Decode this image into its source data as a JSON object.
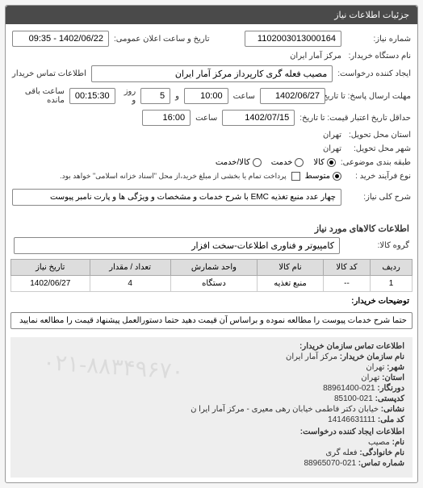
{
  "panel_title": "جزئیات اطلاعات نیاز",
  "fields": {
    "req_no_label": "شماره نیاز:",
    "req_no": "1102003013000164",
    "pub_date_label": "تاریخ و ساعت اعلان عمومی:",
    "pub_date": "1402/06/22 - 09:35",
    "buyer_label": "نام دستگاه خریدار:",
    "buyer": "مرکز آمار ایران",
    "creator_label": "ایجاد کننده درخواست:",
    "creator": "مصیب فعله گری کارپرداز مرکز آمار ایران",
    "contact_label": "اطلاعات تماس خریدار",
    "deadline_label": "مهلت ارسال پاسخ: تا تاریخ:",
    "deadline_date": "1402/06/27",
    "saat_label": "ساعت",
    "deadline_time": "10:00",
    "va_label": "و",
    "deadline_days": "5",
    "rooz_label": "روز و",
    "remain_time": "00:15:30",
    "remain_label": "ساعت باقی مانده",
    "validity_label": "حداقل تاریخ اعتبار قیمت: تا تاریخ:",
    "validity_date": "1402/07/15",
    "validity_time": "16:00",
    "province_label": "استان محل تحویل:",
    "province": "تهران",
    "city_label": "شهر محل تحویل:",
    "city": "تهران",
    "category_label": "طبقه بندی موضوعی:",
    "cat_opt1": "کالا",
    "cat_opt2": "خدمت",
    "cat_opt3": "کالا/خدمت",
    "process_label": "نوع فرآیند خرید :",
    "process_opt1": "متوسط",
    "process_note": "پرداخت تمام یا بخشی از مبلغ خرید،از محل \"اسناد خزانه اسلامی\" خواهد بود.",
    "desc_label": "شرح کلی نیاز:",
    "desc": "چهار عدد منبع تغذیه EMC با شرح خدمات و مشخصات و ویژگی ها و پارت نامبر پیوست"
  },
  "goods_title": "اطلاعات کالاهای مورد نیاز",
  "group_label": "گروه کالا:",
  "group_value": "کامپیوتر و فناوری اطلاعات-سخت افزار",
  "table": {
    "headers": [
      "ردیف",
      "کد کالا",
      "نام کالا",
      "واحد شمارش",
      "تعداد / مقدار",
      "تاریخ نیاز"
    ],
    "rows": [
      {
        "c0": "1",
        "c1": "--",
        "c2": "منبع تغذیه",
        "c3": "دستگاه",
        "c4": "4",
        "c5": "1402/06/27"
      }
    ]
  },
  "buyer_note_label": "توضیحات خریدار:",
  "buyer_note": "حتما شرح خدمات پیوست را مطالعه نموده و براساس آن قیمت دهید حتما دستورالعمل پیشنهاد قیمت را مطالعه نمایید",
  "contact_title": "اطلاعات تماس سازمان خریدار:",
  "watermark": "۰۲۱-۸۸۳۴۹۶۷۰",
  "contact": {
    "org_label": "نام سازمان خریدار:",
    "org": "مرکز آمار ایران",
    "city_label": "شهر:",
    "city": "تهران",
    "province_label": "استان:",
    "province": "تهران",
    "tel_label": "دورنگار:",
    "tel": "021-88961400",
    "post_label": "کدپستی:",
    "post": "021-85100",
    "addr_label": "نشانی:",
    "addr": "خیابان دکتر فاطمی خیابان رهی معیری - مرکز آمار ایرا ن",
    "eco_label": "کد ملی:",
    "eco": "14146631111",
    "creator_title": "اطلاعات ایجاد کننده درخواست:",
    "name_label": "نام:",
    "name": "مصیب",
    "family_label": "نام خانوادگی:",
    "family": "فعله گری",
    "phone_label": "شماره تماس:",
    "phone": "021-88965070"
  }
}
